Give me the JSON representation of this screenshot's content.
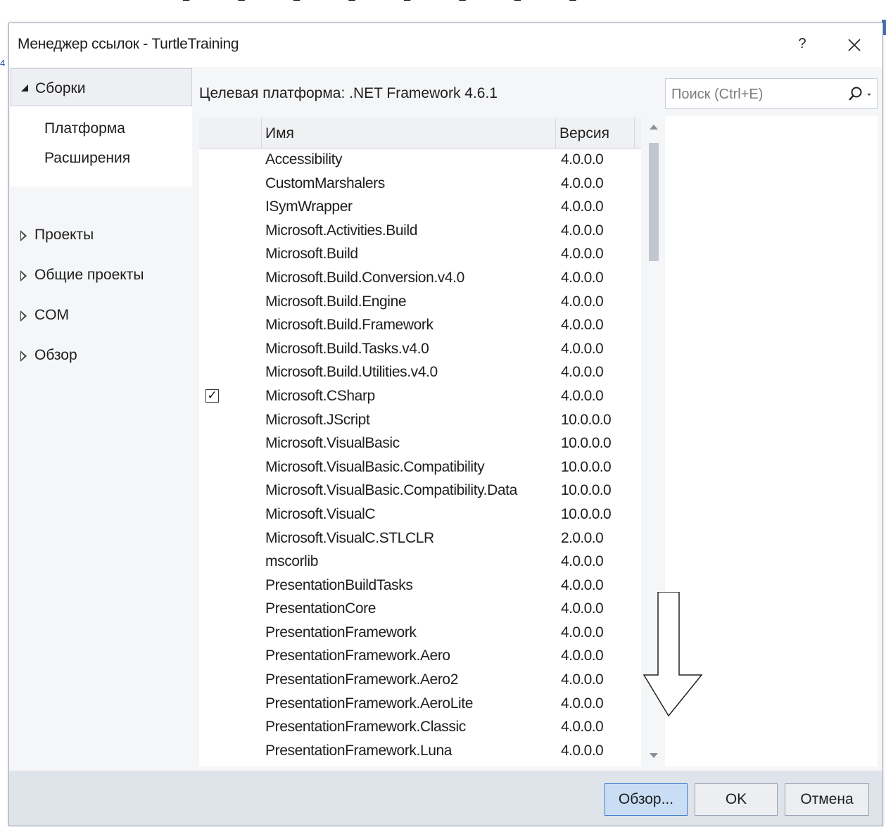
{
  "dialog": {
    "title": "Менеджер ссылок - TurtleTraining",
    "help_label": "?",
    "close_label": "✕"
  },
  "nav": {
    "group": {
      "label": "Сборки",
      "sub_items": [
        "Платформа",
        "Расширения"
      ]
    },
    "items": [
      {
        "label": "Проекты"
      },
      {
        "label": "Общие проекты"
      },
      {
        "label": "COM"
      },
      {
        "label": "Обзор"
      }
    ]
  },
  "main": {
    "platform_label": "Целевая платформа: .NET Framework 4.6.1",
    "columns": {
      "name": "Имя",
      "version": "Версия"
    },
    "rows": [
      {
        "name": "Accessibility",
        "version": "4.0.0.0",
        "checked": false
      },
      {
        "name": "CustomMarshalers",
        "version": "4.0.0.0",
        "checked": false
      },
      {
        "name": "ISymWrapper",
        "version": "4.0.0.0",
        "checked": false
      },
      {
        "name": "Microsoft.Activities.Build",
        "version": "4.0.0.0",
        "checked": false
      },
      {
        "name": "Microsoft.Build",
        "version": "4.0.0.0",
        "checked": false
      },
      {
        "name": "Microsoft.Build.Conversion.v4.0",
        "version": "4.0.0.0",
        "checked": false
      },
      {
        "name": "Microsoft.Build.Engine",
        "version": "4.0.0.0",
        "checked": false
      },
      {
        "name": "Microsoft.Build.Framework",
        "version": "4.0.0.0",
        "checked": false
      },
      {
        "name": "Microsoft.Build.Tasks.v4.0",
        "version": "4.0.0.0",
        "checked": false
      },
      {
        "name": "Microsoft.Build.Utilities.v4.0",
        "version": "4.0.0.0",
        "checked": false
      },
      {
        "name": "Microsoft.CSharp",
        "version": "4.0.0.0",
        "checked": true
      },
      {
        "name": "Microsoft.JScript",
        "version": "10.0.0.0",
        "checked": false
      },
      {
        "name": "Microsoft.VisualBasic",
        "version": "10.0.0.0",
        "checked": false
      },
      {
        "name": "Microsoft.VisualBasic.Compatibility",
        "version": "10.0.0.0",
        "checked": false
      },
      {
        "name": "Microsoft.VisualBasic.Compatibility.Data",
        "version": "10.0.0.0",
        "checked": false
      },
      {
        "name": "Microsoft.VisualC",
        "version": "10.0.0.0",
        "checked": false
      },
      {
        "name": "Microsoft.VisualC.STLCLR",
        "version": "2.0.0.0",
        "checked": false
      },
      {
        "name": "mscorlib",
        "version": "4.0.0.0",
        "checked": false
      },
      {
        "name": "PresentationBuildTasks",
        "version": "4.0.0.0",
        "checked": false
      },
      {
        "name": "PresentationCore",
        "version": "4.0.0.0",
        "checked": false
      },
      {
        "name": "PresentationFramework",
        "version": "4.0.0.0",
        "checked": false
      },
      {
        "name": "PresentationFramework.Aero",
        "version": "4.0.0.0",
        "checked": false
      },
      {
        "name": "PresentationFramework.Aero2",
        "version": "4.0.0.0",
        "checked": false
      },
      {
        "name": "PresentationFramework.AeroLite",
        "version": "4.0.0.0",
        "checked": false
      },
      {
        "name": "PresentationFramework.Classic",
        "version": "4.0.0.0",
        "checked": false
      },
      {
        "name": "PresentationFramework.Luna",
        "version": "4.0.0.0",
        "checked": false
      }
    ],
    "check_glyph": "✓"
  },
  "search": {
    "placeholder": "Поиск (Ctrl+E)",
    "icon": "search-icon"
  },
  "footer": {
    "browse_label": "Обзор...",
    "ok_label": "OK",
    "cancel_label": "Отмена"
  },
  "colors": {
    "dialog_bg": "#f5f6f8",
    "footer_bg": "#dfe3ea",
    "primary_button": "#c9def5",
    "primary_border": "#3d7bd0"
  }
}
